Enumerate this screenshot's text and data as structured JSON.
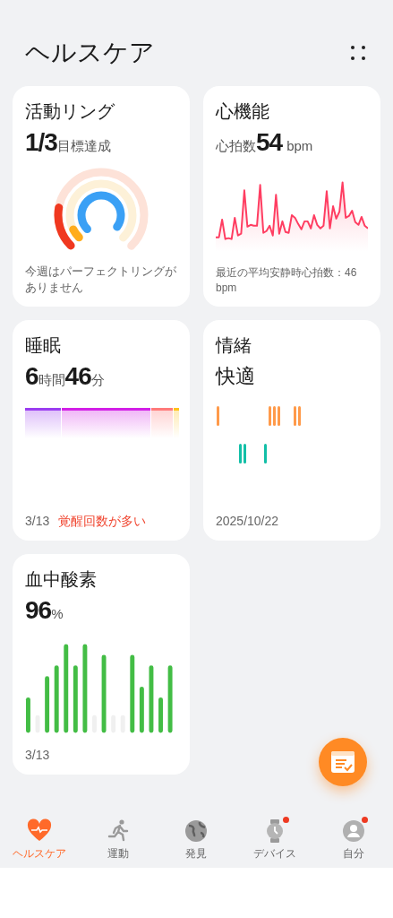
{
  "header": {
    "title": "ヘルスケア"
  },
  "cards": [
    {
      "kind": "rings",
      "title": "活動リング",
      "value": "1/3",
      "unit": "目標達成",
      "footer": "今週はパーフェクトリングがありません"
    },
    {
      "kind": "heart",
      "title": "心機能",
      "prefix": "心拍数",
      "value": "54",
      "unit": "bpm",
      "footer": "最近の平均安静時心拍数：46 bpm"
    },
    {
      "kind": "sleep",
      "title": "睡眠",
      "parts": [
        {
          "value": "6",
          "unit": "時間"
        },
        {
          "value": "46",
          "unit": "分"
        }
      ],
      "date": "3/13",
      "note": "覚醒回数が多い"
    },
    {
      "kind": "mood",
      "title": "情緒",
      "value": "快適",
      "date": "2025/10/22"
    },
    {
      "kind": "spo2",
      "title": "血中酸素",
      "value": "96",
      "unit": "%",
      "date": "3/13"
    }
  ],
  "nav": [
    {
      "label": "ヘルスケア",
      "selected": true,
      "badge": false
    },
    {
      "label": "運動",
      "selected": false,
      "badge": false
    },
    {
      "label": "発見",
      "selected": false,
      "badge": false
    },
    {
      "label": "デバイス",
      "selected": false,
      "badge": true
    },
    {
      "label": "自分",
      "selected": false,
      "badge": true
    }
  ]
}
